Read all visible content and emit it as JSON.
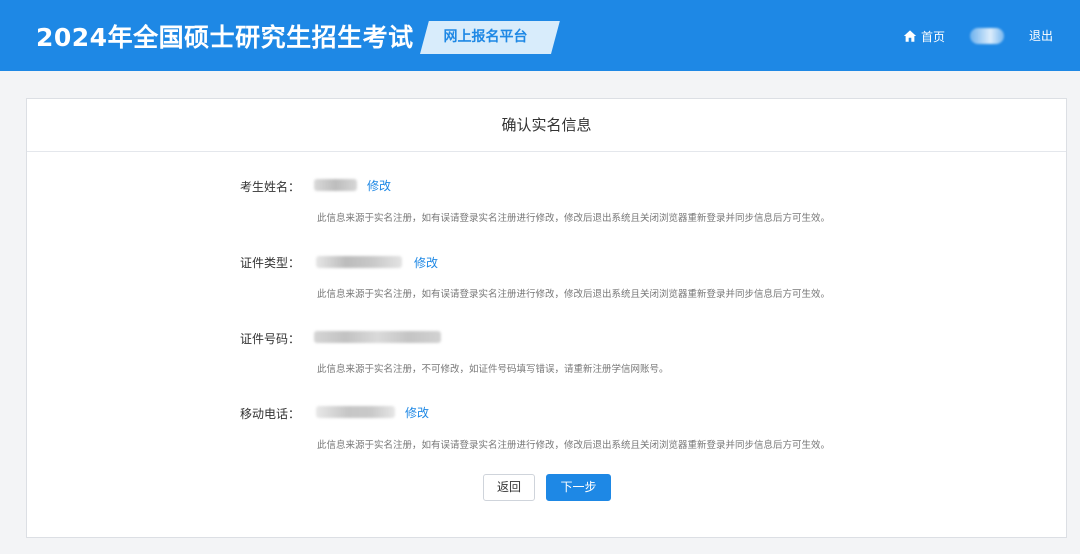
{
  "header": {
    "title": "2024年全国硕士研究生招生考试",
    "platform": "网上报名平台",
    "home": "首页",
    "logout": "退出"
  },
  "card": {
    "title": "确认实名信息",
    "fields": [
      {
        "label": "考生姓名：",
        "edit": "修改",
        "hint": "此信息来源于实名注册，如有误请登录实名注册进行修改，修改后退出系统且关闭浏览器重新登录并同步信息后方可生效。"
      },
      {
        "label": "证件类型：",
        "edit": "修改",
        "hint": "此信息来源于实名注册，如有误请登录实名注册进行修改，修改后退出系统且关闭浏览器重新登录并同步信息后方可生效。"
      },
      {
        "label": "证件号码：",
        "hint": "此信息来源于实名注册，不可修改，如证件号码填写错误，请重新注册学信网账号。"
      },
      {
        "label": "移动电话：",
        "edit": "修改",
        "hint": "此信息来源于实名注册，如有误请登录实名注册进行修改，修改后退出系统且关闭浏览器重新登录并同步信息后方可生效。"
      }
    ],
    "back_label": "返回",
    "next_label": "下一步"
  },
  "colors": {
    "primary": "#1e88e5",
    "platform_bg": "#d8ecfb",
    "page_bg": "#f3f4f6"
  },
  "icons": {
    "home": "home-icon"
  }
}
